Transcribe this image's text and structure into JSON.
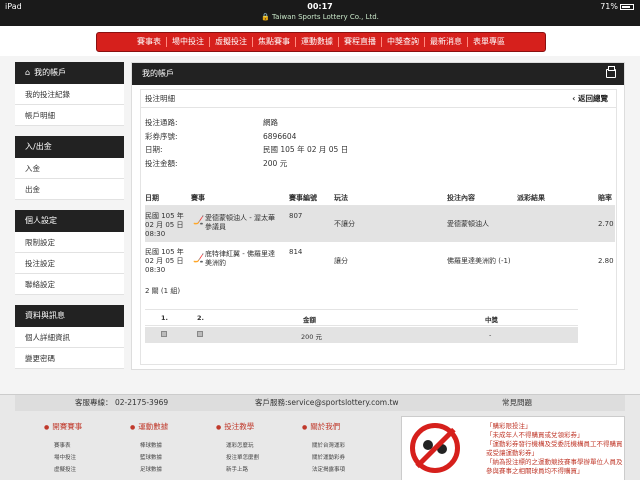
{
  "status_bar": {
    "device": "iPad",
    "time": "00:17",
    "url": "Taiwan Sports Lottery Co., Ltd.",
    "battery": "71%"
  },
  "nav": [
    "賽事表",
    "場中投注",
    "虛擬投注",
    "焦點賽事",
    "運動數據",
    "賽程直播",
    "中獎查詢",
    "最新消息",
    "表單專區"
  ],
  "sidebar": {
    "my_account": "我的帳戶",
    "account_items": [
      "我的投注紀錄",
      "帳戶明細"
    ],
    "deposit_head": "入/出金",
    "deposit_items": [
      "入金",
      "出金"
    ],
    "settings_head": "個人設定",
    "settings_items": [
      "限制設定",
      "投注設定",
      "聯絡設定"
    ],
    "info_head": "資料與訊息",
    "info_items": [
      "個人詳細資訊",
      "變更密碼"
    ]
  },
  "main": {
    "title": "我的帳戶",
    "detail_title": "投注明細",
    "back": "‹ 返回總覽",
    "info": [
      {
        "label": "投注通路:",
        "value": "網路"
      },
      {
        "label": "彩券序號:",
        "value": "6896604"
      },
      {
        "label": "日期:",
        "value": "民國 105 年 02 月 05 日"
      },
      {
        "label": "投注金額:",
        "value": "200 元"
      }
    ],
    "columns": [
      "日期",
      "賽事",
      "賽事編號",
      "玩法",
      "投注內容",
      "派彩結果",
      "賠率"
    ],
    "rows": [
      {
        "date1": "民國 105 年",
        "date2": "02 月 05 日",
        "date3": "08:30",
        "match1": "愛德蒙頓油人 - 渥太華",
        "match2": "參議員",
        "code": "807",
        "play": "不讓分",
        "bet": "愛德蒙頓油人",
        "result": "",
        "odds": "2.70"
      },
      {
        "date1": "民國 105 年",
        "date2": "02 月 05 日",
        "date3": "08:30",
        "match1": "底特律紅翼 - 佛羅里達",
        "match2": "美洲豹",
        "code": "814",
        "play": "讓分",
        "bet": "佛羅里達美洲豹 (-1)",
        "result": "",
        "odds": "2.80"
      }
    ],
    "summary": "2 關 (1 組)",
    "sum_columns": [
      "1.",
      "2.",
      "金額",
      "中獎"
    ],
    "sum_row": {
      "amount": "200 元",
      "win": "-"
    }
  },
  "footer": {
    "service_line": "客服專線：",
    "phone": "02-2175-3969",
    "email": "客戶服務:service@sportslottery.com.tw",
    "faq": "常見問題",
    "cols": [
      {
        "title": "開賽賽事",
        "links": [
          "賽事表",
          "場中投注",
          "虛擬投注"
        ]
      },
      {
        "title": "運動數據",
        "links": [
          "棒球數據",
          "籃球數據",
          "足球數據"
        ]
      },
      {
        "title": "投注教學",
        "links": [
          "運彩怎麼玩",
          "投注單怎麼劃",
          "新手上路"
        ]
      },
      {
        "title": "關於我們",
        "links": [
          "關於台灣運彩",
          "關於運動彩券",
          "法定揭露事項"
        ]
      }
    ],
    "warnings": [
      "「購彩限投注」",
      "「未成年人不得購買或兌領彩券」",
      "「運動彩券發行機構及受委託機構員工不得購買或受讓運動彩券」",
      "「納為投注標的之運動競技賽事學辦單位人員及參與賽事之相關球員均不得購買」"
    ]
  }
}
